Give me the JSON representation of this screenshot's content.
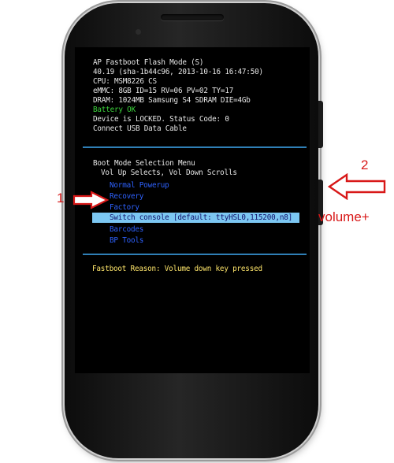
{
  "screen": {
    "header": [
      "AP Fastboot Flash Mode (S)",
      "40.19 (sha-1b44c96, 2013-10-16 16:47:50)",
      "CPU: MSM8226 CS",
      "eMMC: 8GB ID=15 RV=06 PV=02 TY=17",
      "DRAM: 1024MB Samsung S4 SDRAM DIE=4Gb"
    ],
    "battery_status": "Battery OK",
    "lock_status": "Device is LOCKED.  Status Code: 0",
    "connect_hint": "Connect USB Data Cable",
    "menu": {
      "title": "Boot Mode Selection Menu",
      "instructions": "Vol Up Selects, Vol Down Scrolls",
      "items": [
        "Normal Powerup",
        "Recovery",
        "Factory",
        "Switch console [default: ttyHSL0,115200,n8]",
        "Barcodes",
        "BP Tools"
      ],
      "selected_index": 3
    },
    "fastboot_reason": "Fastboot Reason: Volume down key pressed"
  },
  "annotations": {
    "step1_number": "1",
    "step2_number": "2",
    "volume_label": "volume+",
    "arrow_color": "#d81818"
  }
}
